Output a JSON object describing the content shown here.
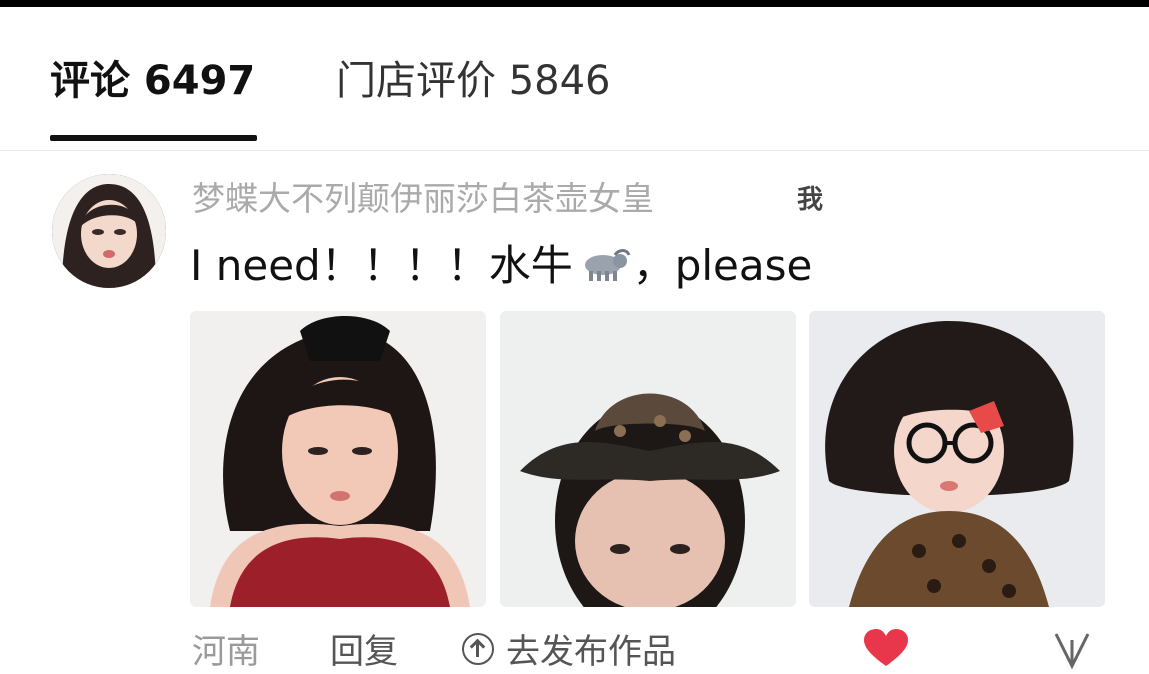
{
  "tabs": {
    "comments": "评论 6497",
    "store_reviews": "门店评价 5846"
  },
  "comment": {
    "username": "梦蝶大不列颠伊丽莎白茶壶女皇",
    "author_badge": "我",
    "text_before": "I need！！！！水牛",
    "text_after": "，please",
    "emoji": "water-buffalo"
  },
  "footer": {
    "location": "河南",
    "reply": "回复",
    "publish": "去发布作品"
  },
  "colors": {
    "like": "#e8374a",
    "text_primary": "#111111",
    "text_secondary": "#aaaaaa"
  }
}
